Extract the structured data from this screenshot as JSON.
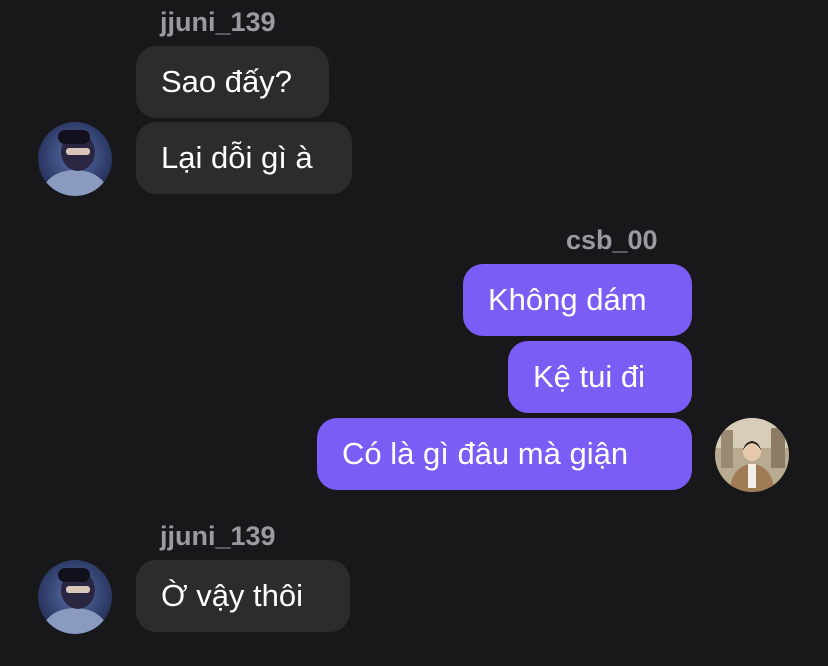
{
  "conversation": {
    "groups": [
      {
        "sender": "jjuni_139",
        "direction": "incoming",
        "messages": [
          "Sao đấy?",
          "Lại dỗi gì à"
        ]
      },
      {
        "sender": "csb_00",
        "direction": "outgoing",
        "messages": [
          "Không dám",
          "Kệ tui đi",
          "Có là gì đâu mà giận"
        ]
      },
      {
        "sender": "jjuni_139",
        "direction": "incoming",
        "messages": [
          "Ờ vậy thôi"
        ]
      }
    ]
  },
  "avatars": {
    "jjuni_139": "profile-photo",
    "csb_00": "profile-photo"
  }
}
